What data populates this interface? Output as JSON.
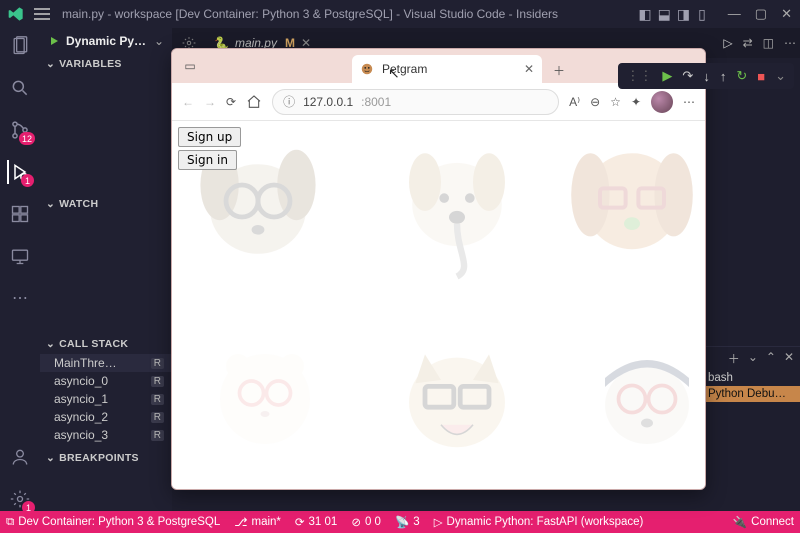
{
  "titlebar": {
    "title": "main.py - workspace [Dev Container: Python 3 & PostgreSQL] - Visual Studio Code - Insiders"
  },
  "activity": {
    "scm_badge": "12",
    "debug_badge": "1",
    "settings_badge": "1"
  },
  "sidebar": {
    "run_config": "Dynamic Pyth…",
    "sections": {
      "variables": "VARIABLES",
      "watch": "WATCH",
      "callstack": "CALL STACK",
      "breakpoints": "BREAKPOINTS"
    },
    "callstack_rows": [
      {
        "label": "MainThre…",
        "badge": "R"
      },
      {
        "label": "asyncio_0",
        "badge": "R"
      },
      {
        "label": "asyncio_1",
        "badge": "R"
      },
      {
        "label": "asyncio_2",
        "badge": "R"
      },
      {
        "label": "asyncio_3",
        "badge": "R"
      }
    ]
  },
  "editor": {
    "tab_filename": "main.py",
    "tab_modified": "M"
  },
  "panel": {
    "items": [
      "bash",
      "Python Debu…"
    ]
  },
  "statusbar": {
    "remote": "Dev Container: Python 3 & PostgreSQL",
    "branch": "main*",
    "sync": "31 01",
    "problems": "0  0",
    "ports": "3",
    "debug_target": "Dynamic Python: FastAPI (workspace)",
    "connect": "Connect"
  },
  "browser": {
    "tab_title": "Petgram",
    "address_host": "127.0.0.1",
    "address_port": ":8001",
    "page": {
      "signup": "Sign up",
      "signin": "Sign in"
    }
  }
}
